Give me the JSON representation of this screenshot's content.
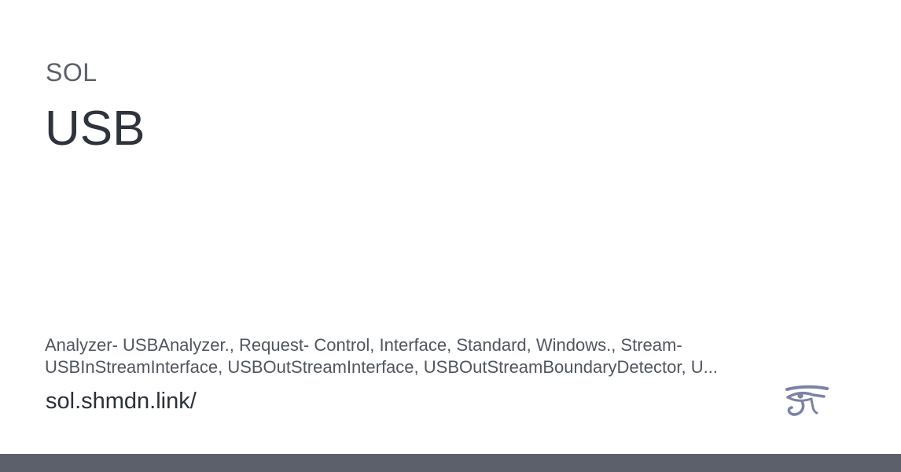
{
  "card": {
    "site_name": "SOL",
    "title": "USB",
    "description": "Analyzer- USBAnalyzer., Request- Control, Interface, Standard, Windows., Stream-\nUSBInStreamInterface, USBOutStreamInterface, USBOutStreamBoundaryDetector, U...",
    "url": "sol.shmdn.link/",
    "logo_icon": "eye-of-horus-icon"
  },
  "colors": {
    "footer_bar": "#5c606b",
    "logo": "#7b82a6",
    "title": "#2f343c"
  }
}
